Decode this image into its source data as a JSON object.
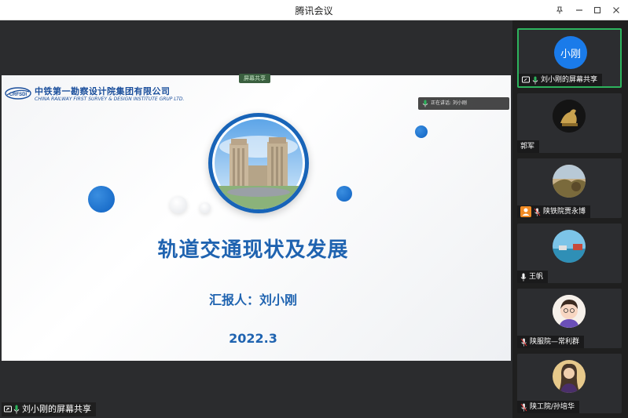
{
  "window": {
    "title": "腾讯会议",
    "controls": {
      "pin": "pin-icon",
      "minimize": "minimize-icon",
      "maximize": "maximize-icon",
      "close": "close-icon"
    }
  },
  "stage": {
    "share_badge": "屏幕共享",
    "speaking_label": "正在讲话: 刘小刚",
    "share_caption": "刘小刚的屏幕共享"
  },
  "slide": {
    "company_cn": "中铁第一勘察设计院集团有限公司",
    "company_en": "CHINA RAILWAY FIRST SURVEY & DESIGN INSTITUTE GRUP LTD.",
    "logo_text": "CRFSDI",
    "title": "轨道交通现状及发展",
    "reporter": "汇报人：刘小刚",
    "date": "2022.3"
  },
  "participants": [
    {
      "name": "刘小刚的屏幕共享",
      "avatar_text": "小刚",
      "icons": [
        "screen-share-icon",
        "mic-on-icon"
      ],
      "active": true
    },
    {
      "name": "郭军",
      "icons": []
    },
    {
      "name": "陕铁院贾永博",
      "icons": [
        "user-badge-icon",
        "mic-off-icon"
      ]
    },
    {
      "name": "王帆",
      "icons": [
        "mic-on-icon"
      ]
    },
    {
      "name": "陕服院—常利群",
      "icons": [
        "mic-off-icon"
      ]
    },
    {
      "name": "陕工院/孙培华",
      "icons": [
        "mic-off-icon"
      ]
    }
  ],
  "colors": {
    "accent_blue": "#1f63b0",
    "active_border": "#2db35d",
    "share_badge_green": "#3a5f3f"
  }
}
